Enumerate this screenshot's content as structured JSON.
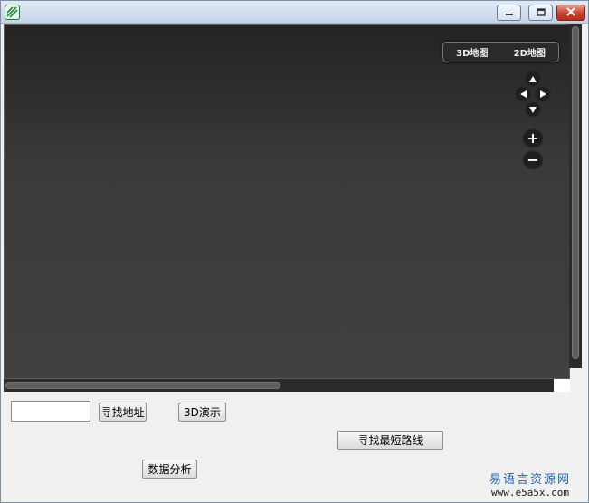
{
  "window": {
    "icon": "app-logo-icon",
    "controls": {
      "minimize_icon": "minimize-icon",
      "maximize_icon": "maximize-icon",
      "close_icon": "close-icon"
    }
  },
  "map": {
    "map_types": [
      "3D地图",
      "2D地图"
    ],
    "pan_icons": [
      "pan-up-icon",
      "pan-left-icon",
      "pan-right-icon",
      "pan-down-icon"
    ],
    "zoom_in_label": "+",
    "zoom_out_label": "−"
  },
  "form": {
    "address_input_value": "",
    "find_address_label": "寻找地址",
    "demo3d_label": "3D演示",
    "shortest_route_label": "寻找最短路线",
    "data_analysis_label": "数据分析"
  },
  "watermark": {
    "line1": "易语言资源网",
    "line2": "www.e5a5x.com"
  },
  "colors": {
    "map_bg": "#3a3a3a",
    "titlebar": "#c4d5ea",
    "close_btn": "#c7402c",
    "watermark": "#1d62b8"
  }
}
